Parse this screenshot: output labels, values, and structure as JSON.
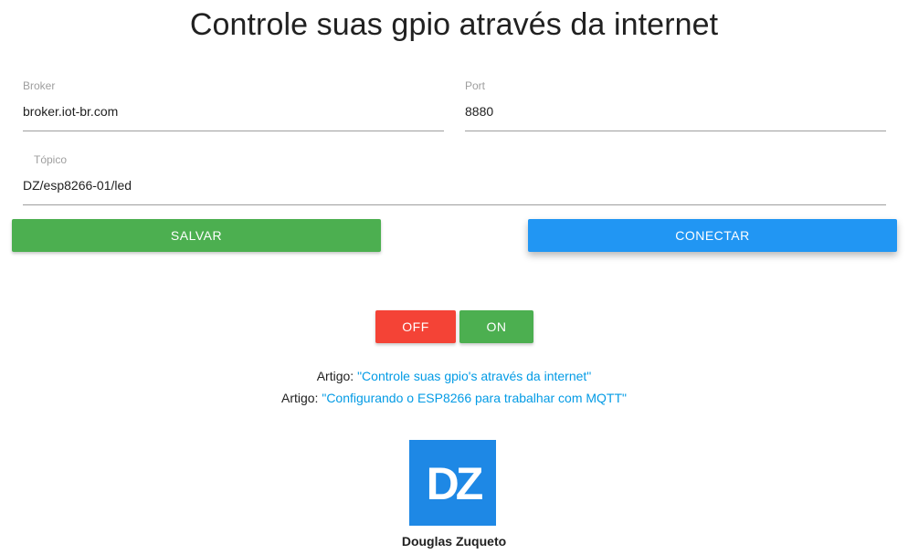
{
  "page": {
    "title": "Controle suas gpio através da internet"
  },
  "form": {
    "broker": {
      "label": "Broker",
      "value": "broker.iot-br.com"
    },
    "port": {
      "label": "Port",
      "value": "8880"
    },
    "topic": {
      "label": "Tópico",
      "value": "DZ/esp8266-01/led"
    }
  },
  "buttons": {
    "save": "SALVAR",
    "connect": "CONECTAR",
    "off": "OFF",
    "on": "ON"
  },
  "articles": [
    {
      "prefix": "Artigo: ",
      "link_text": "\"Controle suas gpio's através da internet\""
    },
    {
      "prefix": "Artigo: ",
      "link_text": "\"Configurando o ESP8266 para trabalhar com MQTT\""
    }
  ],
  "author": {
    "logo_text": "DZ",
    "name": "Douglas Zuqueto"
  },
  "colors": {
    "save": "#4caf50",
    "connect": "#2196f3",
    "off": "#f44336",
    "on": "#4caf50",
    "link": "#039be5",
    "logo_bg": "#1e88e5"
  }
}
